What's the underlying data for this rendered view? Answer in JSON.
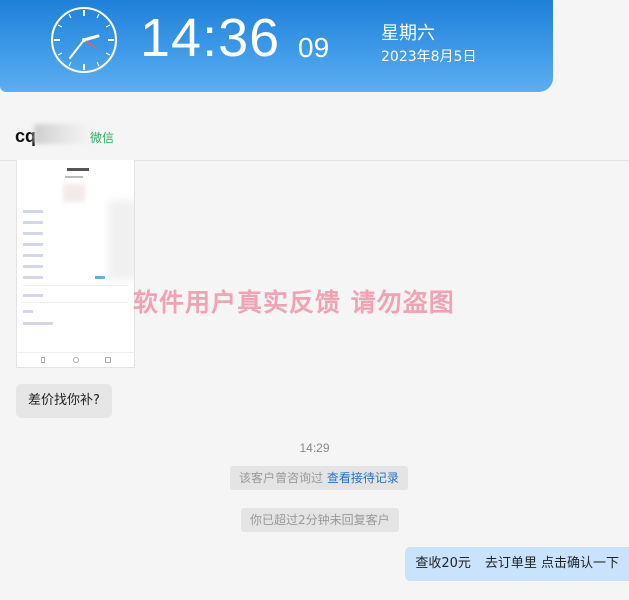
{
  "clock": {
    "time": "14:36",
    "seconds": "09",
    "weekday": "星期六",
    "date": "2023年8月5日"
  },
  "chat": {
    "contact_name": "cq",
    "channel": "微信",
    "watermark": "软件用户真实反馈  请勿盗图",
    "messages": {
      "customer_text": "差价找你补?",
      "timestamp": "14:29",
      "consult_note": "该客户曾咨询过",
      "consult_link": "查看接待记录",
      "timeout_note": "你已超过2分钟未回复客户",
      "agent_reply_part1": "查收20元",
      "agent_reply_part2": "去订单里 点击确认一下"
    }
  },
  "colors": {
    "banner": "#3e9ae8",
    "agent_bubble": "#c8e3fb",
    "watermark": "#f1a3b4",
    "channel": "#2aae67",
    "link": "#2a6fc4"
  }
}
